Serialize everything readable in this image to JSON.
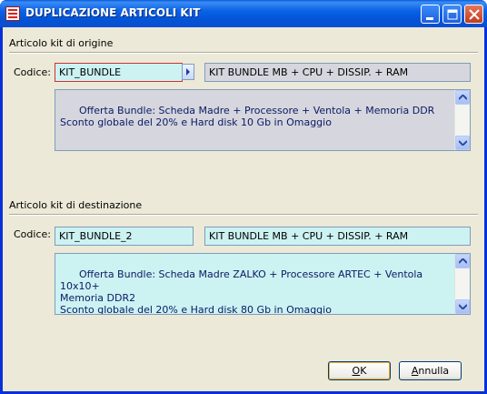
{
  "window": {
    "title": "DUPLICAZIONE ARTICOLI KIT",
    "controls": [
      "minimize-icon",
      "maximize-icon",
      "close-icon"
    ]
  },
  "origin": {
    "section_label": "Articolo kit di origine",
    "code_label": "Codice:",
    "code_value": "KIT_BUNDLE",
    "description": "KIT BUNDLE MB + CPU + DISSIP. + RAM",
    "notes": "Offerta Bundle: Scheda Madre + Processore + Ventola + Memoria DDR\nSconto globale del 20% e Hard disk 10 Gb in Omaggio"
  },
  "destination": {
    "section_label": "Articolo kit di destinazione",
    "code_label": "Codice:",
    "code_value": "KIT_BUNDLE_2",
    "description": "KIT BUNDLE MB + CPU + DISSIP. + RAM",
    "notes": "Offerta Bundle: Scheda Madre ZALKO + Processore ARTEC + Ventola 10x10+\nMemoria DDR2\nSconto globale del 20% e Hard disk 80 Gb in Omaggio"
  },
  "buttons": {
    "ok_first": "O",
    "ok_rest": "K",
    "cancel_first": "A",
    "cancel_rest": "nnulla"
  },
  "colors": {
    "titlebar": "#0a62e6",
    "field_cyan": "#ccf2f2",
    "field_grey": "#d6d6de",
    "dialog_bg": "#ece9d8"
  }
}
